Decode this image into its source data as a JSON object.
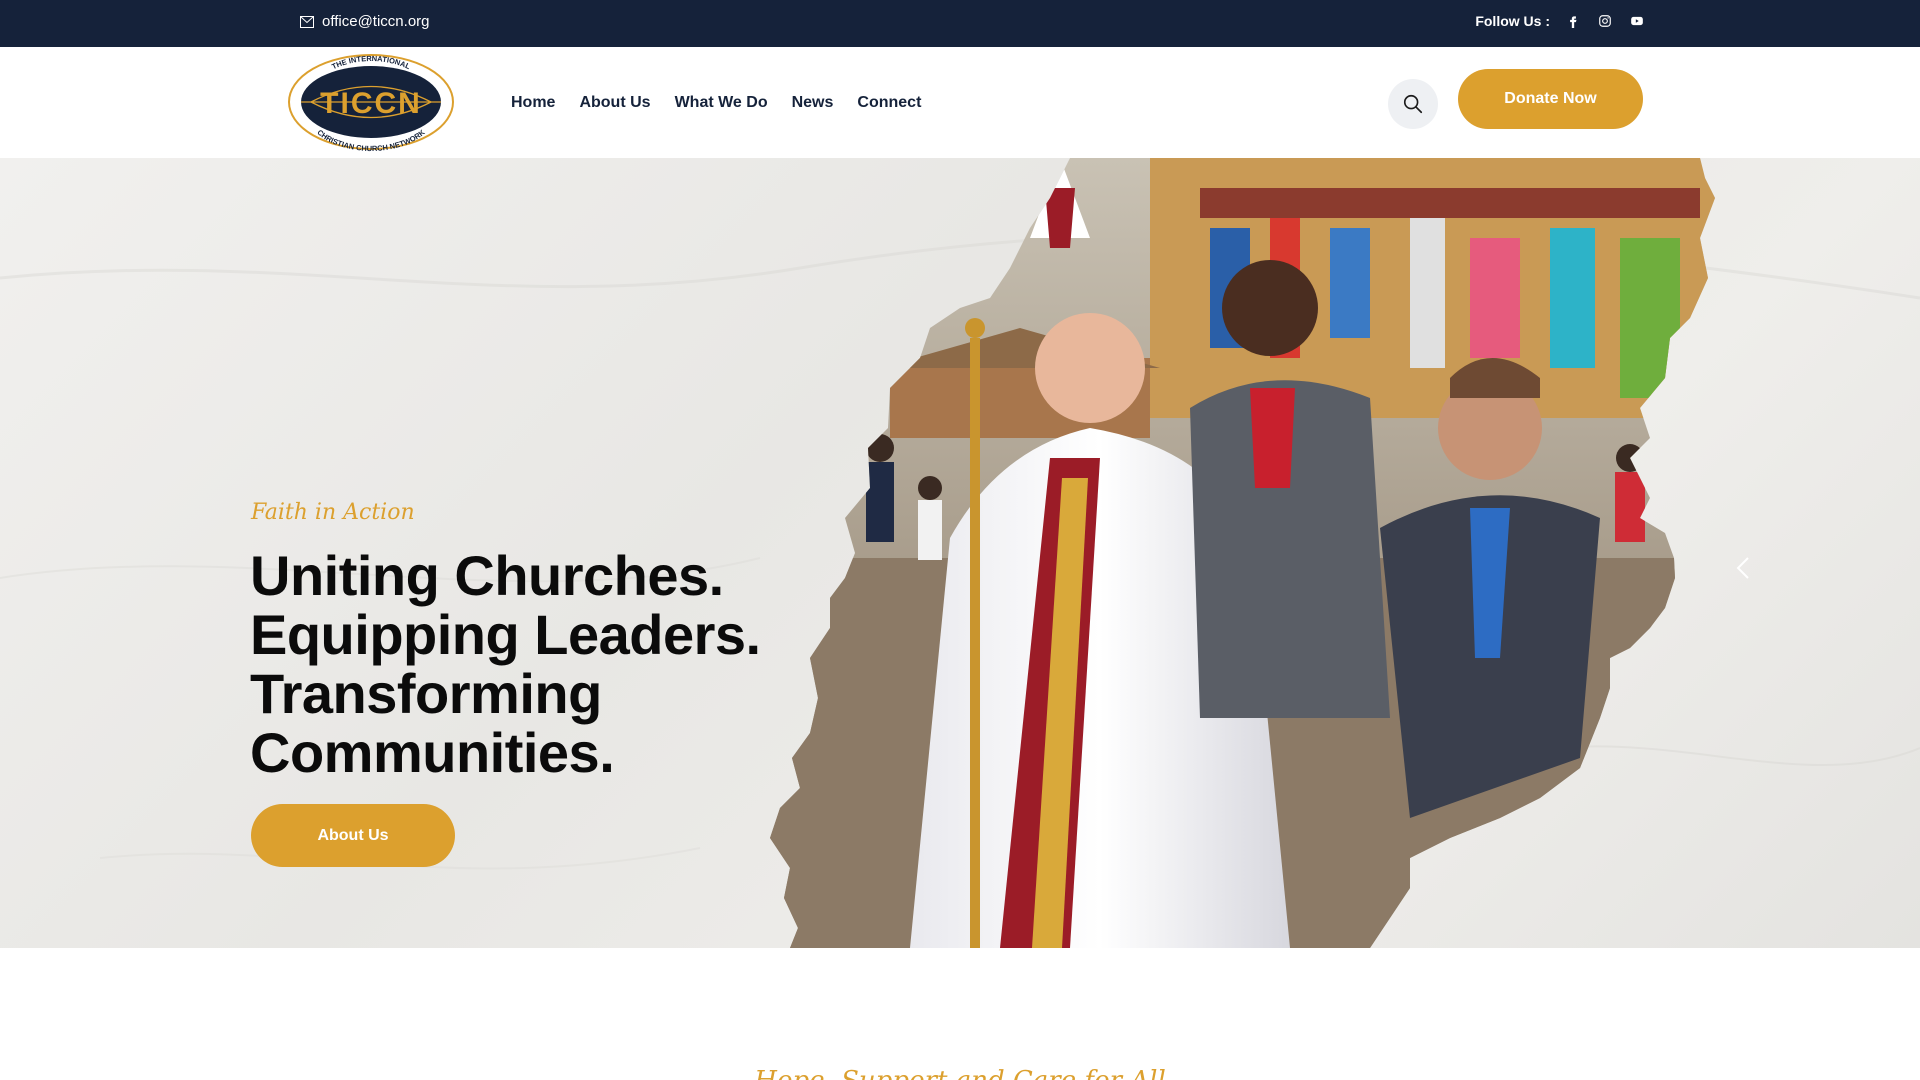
{
  "topbar": {
    "email": "office@ticcn.org",
    "follow_label": "Follow Us :",
    "social": [
      "facebook-icon",
      "instagram-icon",
      "youtube-icon"
    ]
  },
  "logo": {
    "arc_top": "THE INTERNATIONAL",
    "wordmark": "TICCN",
    "arc_bottom": "CHRISTIAN CHURCH NETWORK"
  },
  "nav": {
    "items": [
      "Home",
      "About Us",
      "What We Do",
      "News",
      "Connect"
    ]
  },
  "header": {
    "search_icon": "search-icon",
    "donate_label": "Donate Now"
  },
  "hero": {
    "kicker": "Faith in Action",
    "headline": [
      "Uniting Churches.",
      "Equipping Leaders.",
      "Transforming",
      "Communities."
    ],
    "button_label": "About Us",
    "slider_icon": "chevron-left-icon"
  },
  "section": {
    "kicker": "Hope, Support and Care for All"
  },
  "colors": {
    "topbar_bg": "#15223a",
    "accent": "#dca02e",
    "nav_text": "#15223a",
    "headline_text": "#0b0b0b"
  }
}
